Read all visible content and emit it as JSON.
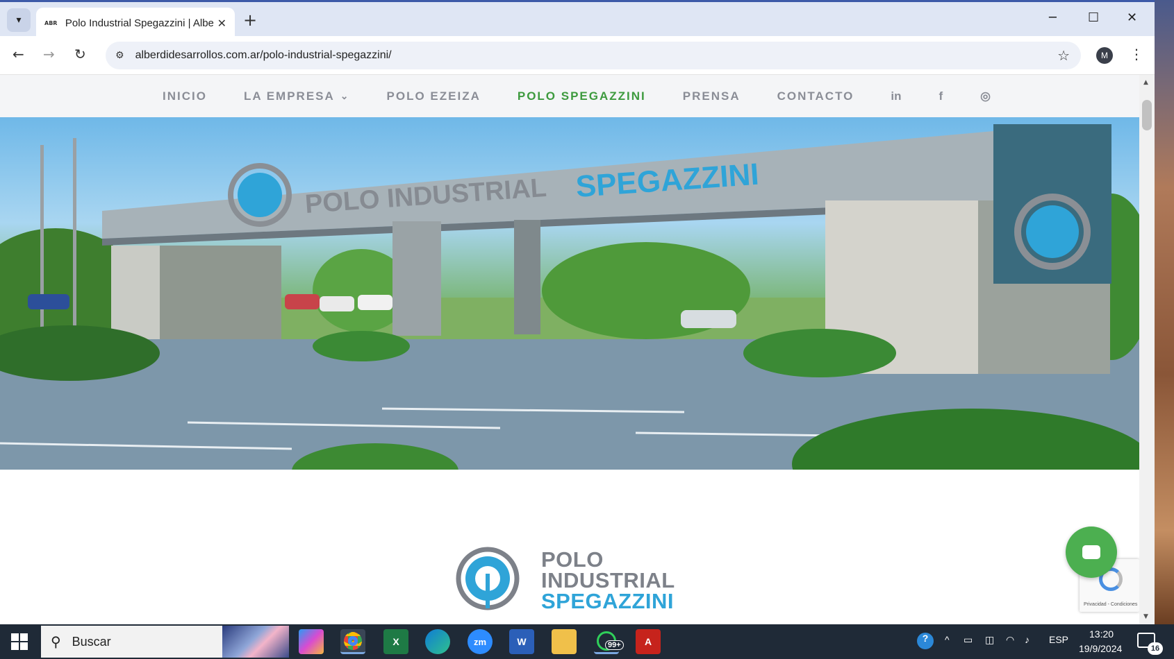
{
  "browser": {
    "tab_title": "Polo Industrial Spegazzini | Albe",
    "tab_favicon_text": "ABR",
    "url": "alberdidesarrollos.com.ar/polo-industrial-spegazzini/",
    "profile_initial": "M"
  },
  "site_nav": {
    "items": [
      {
        "label": "INICIO",
        "active": false
      },
      {
        "label": "LA EMPRESA",
        "active": false,
        "has_dropdown": true
      },
      {
        "label": "POLO EZEIZA",
        "active": false
      },
      {
        "label": "POLO SPEGAZZINI",
        "active": true
      },
      {
        "label": "PRENSA",
        "active": false
      },
      {
        "label": "CONTACTO",
        "active": false
      }
    ],
    "social": [
      "in",
      "f",
      "◎"
    ],
    "dropdown_glyph": "⌄"
  },
  "hero": {
    "sign_text_gray": "POLO INDUSTRIAL",
    "sign_text_blue": "SPEGAZZINI"
  },
  "logo": {
    "line1": "POLO",
    "line2": "INDUSTRIAL",
    "line3": "SPEGAZZINI"
  },
  "recaptcha": {
    "text": "Privacidad - Condiciones"
  },
  "taskbar": {
    "search_label": "Buscar",
    "apps": [
      "copilot-icon",
      "chrome-icon",
      "excel-icon",
      "edge-icon",
      "zoom-icon",
      "word-icon",
      "file-explorer-icon",
      "whatsapp-icon",
      "acrobat-icon"
    ],
    "whatsapp_badge": "99+",
    "language": "ESP",
    "time": "13:20",
    "date": "19/9/2024",
    "notification_count": "16"
  },
  "colors": {
    "nav_active": "#3d9a3e",
    "nav_text": "#8a8d96",
    "brand_blue": "#2fa4d8",
    "brand_gray": "#7d8189",
    "chat_green": "#4caf50"
  }
}
